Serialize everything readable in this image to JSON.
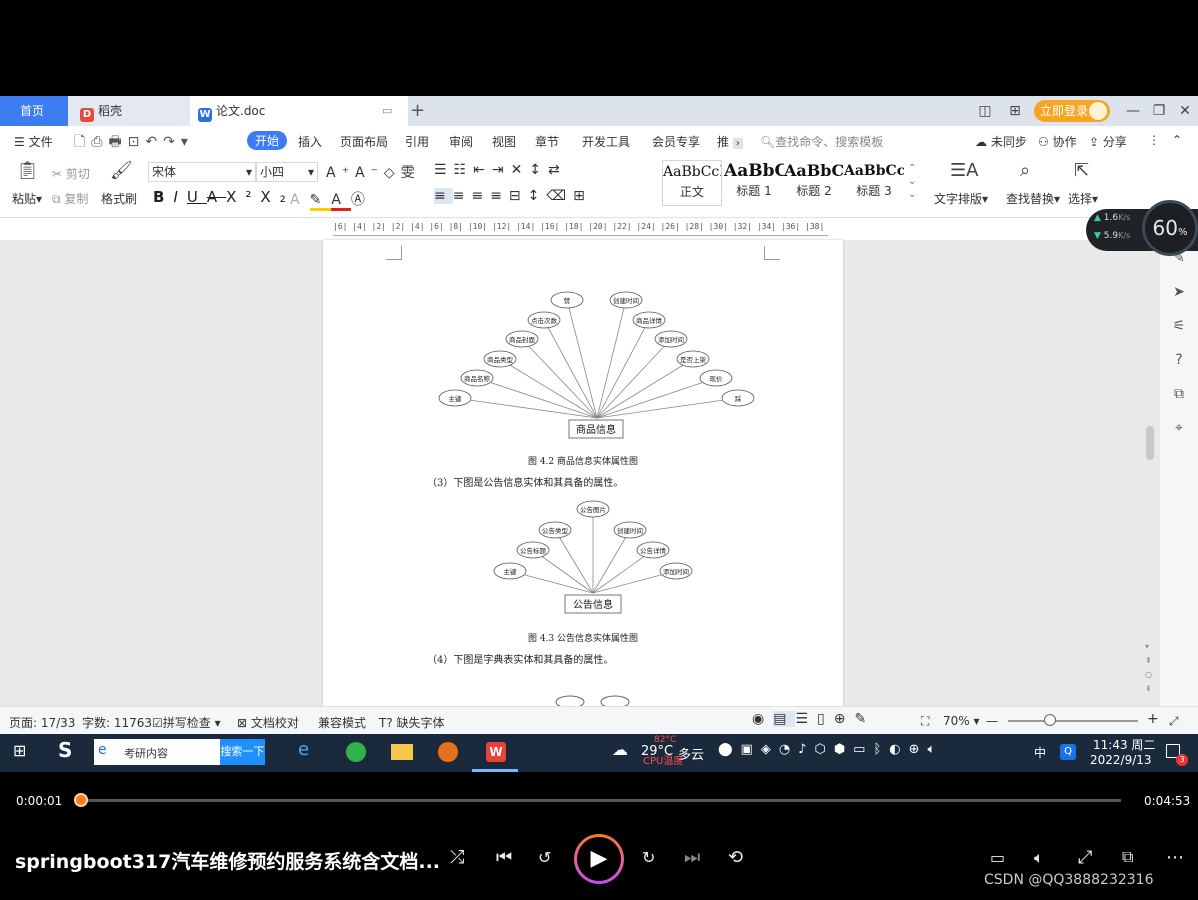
{
  "tabs": {
    "home": "首页",
    "daoke": "稻壳",
    "doc": "论文.doc"
  },
  "login": "立即登录",
  "menu": {
    "file": "文件",
    "items": [
      "开始",
      "插入",
      "页面布局",
      "引用",
      "审阅",
      "视图",
      "章节",
      "开发工具",
      "会员专享",
      "推"
    ],
    "search_placeholder": "查找命令、搜索模板",
    "sync": "未同步",
    "collab": "协作",
    "share": "分享"
  },
  "ribbon": {
    "paste": "粘贴",
    "cut": "剪切",
    "copy": "复制",
    "format_painter": "格式刷",
    "font": "宋体",
    "size": "小四",
    "styles": [
      {
        "preview": "AaBbCcI",
        "name": "正文"
      },
      {
        "preview": "AaBbC",
        "name": "标题 1"
      },
      {
        "preview": "AaBbC",
        "name": "标题 2"
      },
      {
        "preview": "AaBbCcI",
        "name": "标题 3"
      }
    ],
    "text_layout": "文字排版",
    "find_replace": "查找替换",
    "select": "选择"
  },
  "ruler": "|6| |4| |2| |2| |4| |6| |8| |10| |12| |14| |16| |18| |20| |22| |24| |26| |28| |30| |32| |34| |36| |38| |40|",
  "doc": {
    "fig42": {
      "center": "商品信息",
      "attrs": [
        "主键",
        "商品名称",
        "商品类型",
        "商品封面",
        "点击次数",
        "赞",
        "创建时间",
        "商品详情",
        "添加时间",
        "是否上架",
        "现价",
        "踩"
      ],
      "caption": "图 4.2 商品信息实体属性图"
    },
    "para3": "（3）下图是公告信息实体和其具备的属性。",
    "fig43": {
      "center": "公告信息",
      "attrs": [
        "主键",
        "公告标题",
        "公告类型",
        "公告图片",
        "创建时间",
        "公告详情",
        "添加时间"
      ],
      "caption": "图 4.3 公告信息实体属性图"
    },
    "para4": "（4）下图是字典表实体和其具备的属性。"
  },
  "speed": {
    "up": "1.6",
    "down": "5.9",
    "unit": "K/s",
    "percent": "60",
    "percent_unit": "%"
  },
  "status": {
    "page": "页面: 17/33",
    "words": "字数: 11763",
    "spell": "拼写检查",
    "proof": "文档校对",
    "compat": "兼容模式",
    "missing_font": "缺失字体",
    "zoom": "70%"
  },
  "taskbar": {
    "search_placeholder": "考研内容",
    "search_btn": "搜索一下",
    "temp": "29°C",
    "weather": "多云",
    "cpu_temp": "82°C",
    "cpu_label": "CPU温度",
    "ime": "中",
    "time": "11:43 周二",
    "date": "2022/9/13",
    "badge": "3"
  },
  "player": {
    "current": "0:00:01",
    "total": "0:04:53",
    "progress": 0.0034,
    "title": "springboot317汽车维修预约服务系统含文档...",
    "watermark": "CSDN @QQ3888232316",
    "colors": {
      "accent": "#ff7a1a"
    }
  }
}
